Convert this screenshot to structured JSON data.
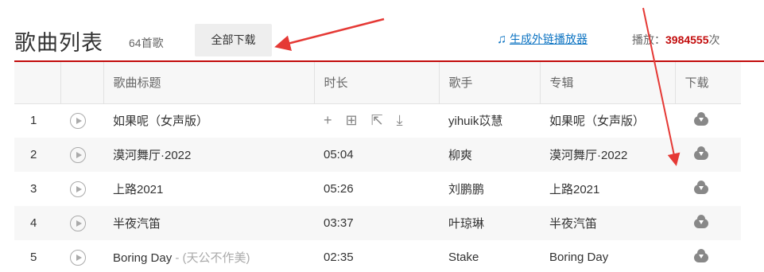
{
  "header": {
    "title": "歌曲列表",
    "count": "64首歌",
    "download_all": "全部下载",
    "ext_player_icon": "music-note-icon",
    "ext_player_note": "♫",
    "ext_player": "生成外链播放器",
    "plays_label": "播放：",
    "plays_count": "3984555",
    "plays_unit": "次"
  },
  "columns": [
    "",
    "",
    "歌曲标题",
    "时长",
    "歌手",
    "专辑",
    "下载"
  ],
  "songs": [
    {
      "index": "1",
      "title": "如果呢（女声版）",
      "alias": "",
      "duration": "",
      "ops": "+ ⊞ ⇱ ⤓",
      "artist": "yihuik苡慧",
      "album": "如果呢（女声版）"
    },
    {
      "index": "2",
      "title": "漠河舞厅·2022",
      "alias": "",
      "duration": "05:04",
      "ops": "",
      "artist": "柳爽",
      "album": "漠河舞厅·2022"
    },
    {
      "index": "3",
      "title": "上路2021",
      "alias": "",
      "duration": "05:26",
      "ops": "",
      "artist": "刘鹏鹏",
      "album": "上路2021"
    },
    {
      "index": "4",
      "title": "半夜汽笛",
      "alias": "",
      "duration": "03:37",
      "ops": "",
      "artist": "叶琼琳",
      "album": "半夜汽笛"
    },
    {
      "index": "5",
      "title": "Boring Day",
      "alias": " - (天公不作美)",
      "duration": "02:35",
      "ops": "",
      "artist": "Stake",
      "album": "Boring Day"
    }
  ],
  "colors": {
    "accent_red": "#c20c0c",
    "link_blue": "#0c73c2",
    "annotation_arrow": "#e53935"
  }
}
